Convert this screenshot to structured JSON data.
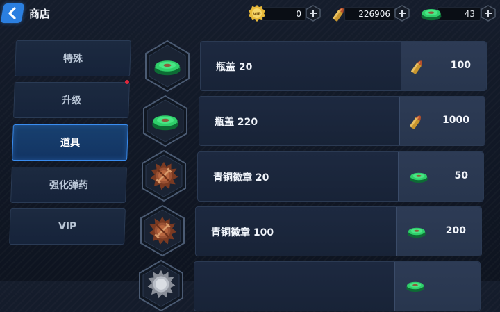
{
  "header": {
    "title": "商店",
    "back_icon": "back-arrow-icon"
  },
  "currencies": [
    {
      "name": "vip-coin",
      "value": "0",
      "icon": "vip-coin-icon",
      "color": "#e8b93a"
    },
    {
      "name": "bullets",
      "value": "226906",
      "icon": "bullet-icon",
      "color": "#d9a13b"
    },
    {
      "name": "bottle-caps",
      "value": "43",
      "icon": "bottle-cap-icon",
      "color": "#2fcf6a"
    }
  ],
  "menu": {
    "items": [
      {
        "label": "特殊",
        "active": false,
        "badge": false
      },
      {
        "label": "升级",
        "active": false,
        "badge": true
      },
      {
        "label": "道具",
        "active": true,
        "badge": false
      },
      {
        "label": "强化弹药",
        "active": false,
        "badge": false
      },
      {
        "label": "VIP",
        "active": false,
        "badge": false
      }
    ]
  },
  "shop_items": [
    {
      "name": "瓶盖 20",
      "icon": "bottle-cap-icon",
      "price": "100",
      "price_icon": "bullet-icon"
    },
    {
      "name": "瓶盖 220",
      "icon": "bottle-cap-icon",
      "price": "1000",
      "price_icon": "bullet-icon"
    },
    {
      "name": "青铜徽章 20",
      "icon": "bronze-badge-icon",
      "price": "50",
      "price_icon": "bottle-cap-icon"
    },
    {
      "name": "青铜徽章 100",
      "icon": "bronze-badge-icon",
      "price": "200",
      "price_icon": "bottle-cap-icon"
    },
    {
      "name": "",
      "icon": "silver-badge-icon",
      "price": "",
      "price_icon": "bottle-cap-icon"
    }
  ],
  "colors": {
    "accent": "#2b7fe0",
    "active_menu": "#18406f",
    "badge_red": "#e0283c"
  }
}
